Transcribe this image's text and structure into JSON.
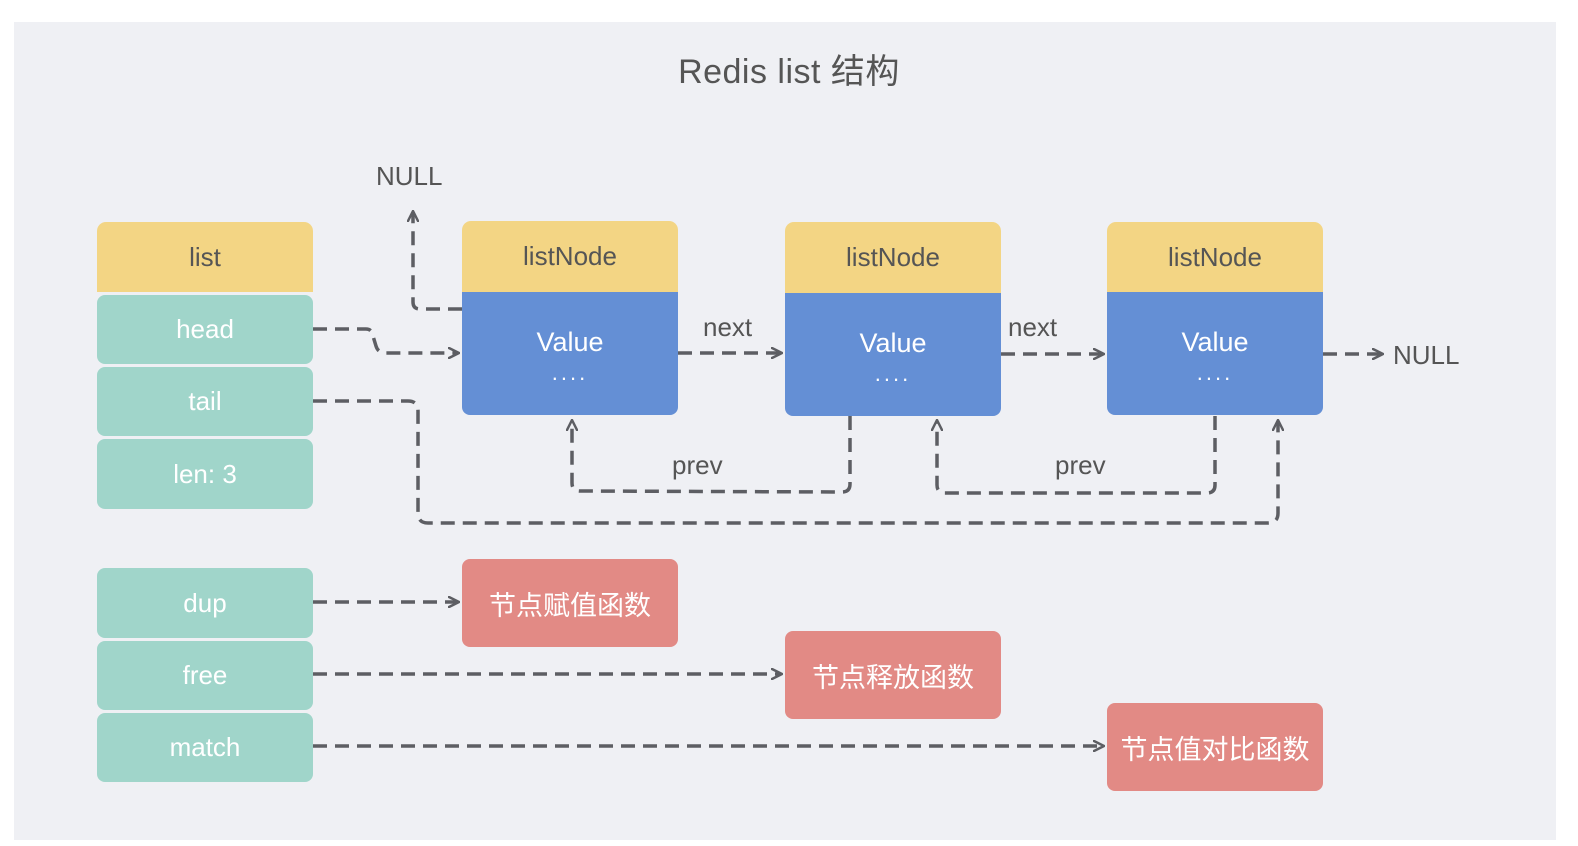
{
  "title": "Redis list 结构",
  "list_struct": {
    "header": "list",
    "fields": [
      "head",
      "tail",
      "len: 3"
    ],
    "functions": [
      "dup",
      "free",
      "match"
    ]
  },
  "nodes": [
    {
      "header": "listNode",
      "value": "Value",
      "more": "...."
    },
    {
      "header": "listNode",
      "value": "Value",
      "more": "...."
    },
    {
      "header": "listNode",
      "value": "Value",
      "more": "...."
    }
  ],
  "edge_labels": {
    "next": "next",
    "prev": "prev",
    "null": "NULL"
  },
  "function_boxes": [
    "节点赋值函数",
    "节点释放函数",
    "节点值对比函数"
  ],
  "colors": {
    "header": "#f3d584",
    "field": "#a0d5ca",
    "node_value": "#648fd5",
    "function_box": "#e28a85",
    "arrow": "#5d5e63",
    "background": "#eff0f4"
  }
}
